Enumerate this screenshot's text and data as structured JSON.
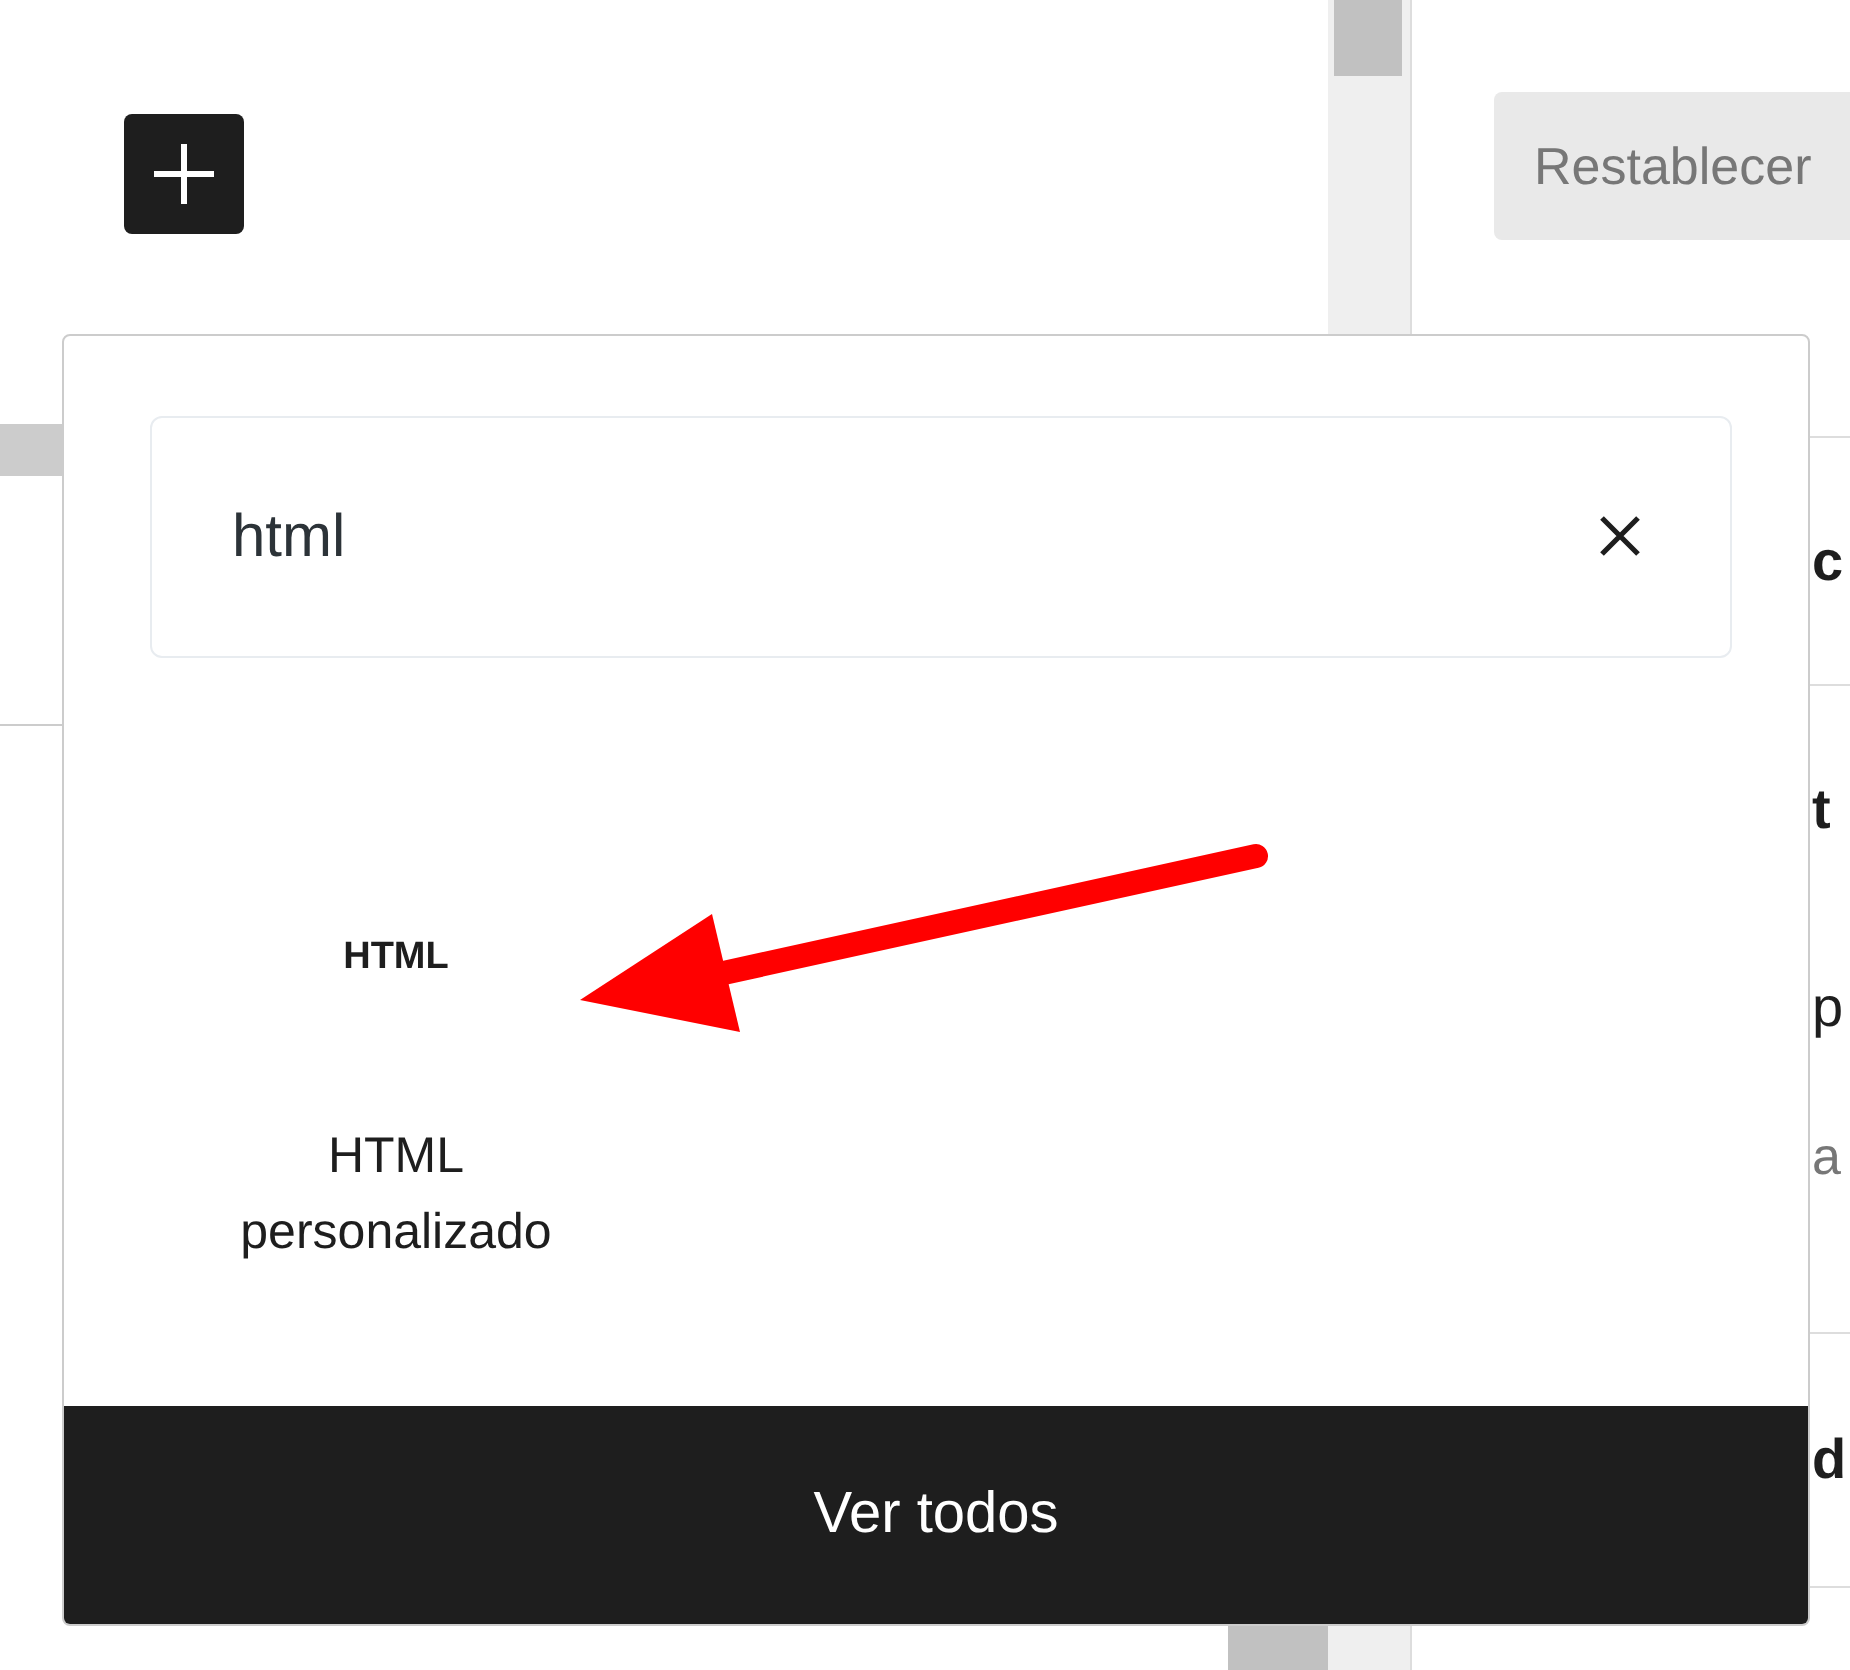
{
  "sidebar": {
    "reset_button": "Restablecer",
    "sections": [
      {
        "texts": [
          {
            "text": "c",
            "kind": "heading"
          }
        ]
      },
      {
        "texts": [
          {
            "text": "t",
            "kind": "heading"
          },
          {
            "text": "p",
            "kind": "body"
          },
          {
            "text": "a",
            "kind": "hint"
          }
        ]
      },
      {
        "texts": [
          {
            "text": "d",
            "kind": "heading"
          }
        ]
      }
    ]
  },
  "inserter": {
    "search": {
      "value": "html"
    },
    "results": [
      {
        "icon_text": "HTML",
        "label": "HTML personalizado"
      }
    ],
    "footer_button": "Ver todos"
  }
}
